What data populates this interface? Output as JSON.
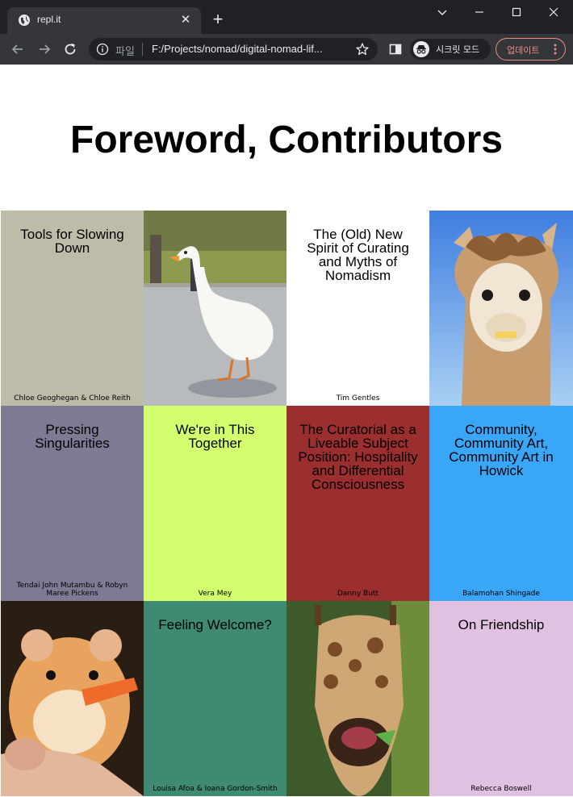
{
  "browser": {
    "tab_title": "repl.it",
    "url_scheme": "파일",
    "url": "F:/Projects/nomad/digital-nomad-lif...",
    "incognito_label": "시크릿 모드",
    "update_label": "업데이트",
    "icons": [
      "globe-icon",
      "close-icon",
      "plus-icon",
      "chevron-down-icon",
      "minimize-icon",
      "maximize-icon",
      "window-close-icon",
      "back-icon",
      "forward-icon",
      "reload-icon",
      "info-icon",
      "star-icon",
      "sidebar-icon",
      "incognito-icon",
      "kebab-icon"
    ]
  },
  "page": {
    "title": "Foreword, Contributors",
    "tiles": [
      {
        "kind": "text",
        "title": "Tools for Slowing Down",
        "author": "Chloe Geoghegan & Chloe Reith",
        "bg": "#bebca8"
      },
      {
        "kind": "photo",
        "subject": "goose"
      },
      {
        "kind": "text",
        "title": "The (Old) New Spirit of Curating and Myths of Nomadism",
        "author": "Tim Gentles",
        "bg": "#ffffff"
      },
      {
        "kind": "photo",
        "subject": "alpaca"
      },
      {
        "kind": "text",
        "title": "Pressing Singularities",
        "author": "Tendai John Mutambu & Robyn Maree Pickens",
        "bg": "#7f7a93"
      },
      {
        "kind": "text",
        "title": "We're in This Together",
        "author": "Vera Mey",
        "bg": "#d3ff6f"
      },
      {
        "kind": "text",
        "title": "The Curatorial as a Liveable Subject Position: Hospitality and Differential Consciousness",
        "author": "Danny Butt",
        "bg": "#9b2f30"
      },
      {
        "kind": "text",
        "title": "Community, Community Art, Community Art in Howick",
        "author": "Balamohan Shingade",
        "bg": "#3aa6f8"
      },
      {
        "kind": "photo",
        "subject": "hamster"
      },
      {
        "kind": "text",
        "title": "Feeling Welcome?",
        "author": "Louisa Afoa & Ioana Gordon-Smith",
        "bg": "#3e8a72"
      },
      {
        "kind": "photo",
        "subject": "giraffe"
      },
      {
        "kind": "text",
        "title": "On Friendship",
        "author": "Rebecca Boswell",
        "bg": "#e1c1e2"
      }
    ]
  }
}
